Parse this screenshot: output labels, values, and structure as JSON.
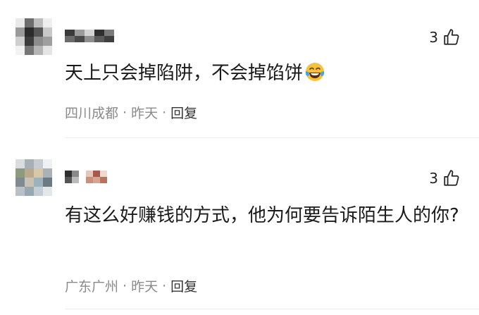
{
  "comments": [
    {
      "likes": "3",
      "text": "天上只会掉陷阱，不会掉馅饼",
      "location": "四川成都",
      "time": "昨天",
      "reply_label": "回复",
      "trailing_icon": "laughing-tears-emoji-icon"
    },
    {
      "likes": "3",
      "text": "有这么好赚钱的方式，他为何要告诉陌生人的你?",
      "location": "广东广州",
      "time": "昨天",
      "reply_label": "回复"
    }
  ],
  "separator": "·",
  "colors": {
    "meta_text": "#8a8a8a",
    "body_text": "#1a1a1a",
    "divider": "#ececec",
    "emoji_face": "#f7c23a",
    "emoji_tears": "#3fa3f0"
  }
}
